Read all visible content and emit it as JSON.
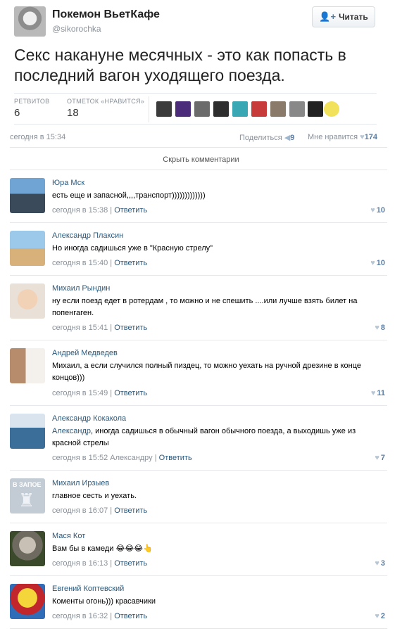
{
  "tweet": {
    "author_name": "Покемон ВьетКафе",
    "author_handle": "@sikorochka",
    "follow_label": "Читать",
    "text": "Секс накануне месячных - это как попасть в последний вагон уходящего поезда.",
    "retweets_label": "РЕТВИТОВ",
    "retweets_count": "6",
    "likes_label": "ОТМЕТОК «НРАВИТСЯ»",
    "likes_count": "18",
    "time": "сегодня в 15:34",
    "share_label": "Поделиться",
    "share_count": "9",
    "like_label": "Мне нравится",
    "like_count": "174"
  },
  "hide_comments_label": "Скрыть комментарии",
  "reply_label": "Ответить",
  "comments": [
    {
      "name": "Юра Мск",
      "text": "есть еще и запасной,,,,транспорт)))))))))))))",
      "time": "сегодня в 15:38",
      "likes": "10"
    },
    {
      "name": "Александр Плаксин",
      "text": "Но иногда садишься уже в \"Красную стрелу\"",
      "time": "сегодня в 15:40",
      "likes": "10"
    },
    {
      "name": "Михаил Рындин",
      "text": "ну если поезд едет в ротердам , то можно и не спешить ....или лучше взять билет на попенгаген.",
      "time": "сегодня в 15:41",
      "likes": "8"
    },
    {
      "name": "Андрей Медведев",
      "text": "Михаил, а если случился полный пиздец, то можно уехать на ручной дрезине в конце концов)))",
      "time": "сегодня в 15:49",
      "likes": "11"
    },
    {
      "name": "Александр Кокакола",
      "text_prefix": "Александр",
      "text": ", иногда садишься в обычный вагон обычного поезда, а выходишь уже из красной стрелы",
      "time": "сегодня в 15:52",
      "reply_to": "Александру",
      "likes": "7"
    },
    {
      "name": "Михаил Ирзыев",
      "avatar_text": "В ЗАПОЕ",
      "text": "главное сесть и уехать.",
      "time": "сегодня в 16:07",
      "likes": ""
    },
    {
      "name": "Мася Кот",
      "text": "Вам бы в камеди 😂😂😂👆",
      "time": "сегодня в 16:13",
      "likes": "3"
    },
    {
      "name": "Евгений Коптевский",
      "text": "Коменты огонь))) красавчики",
      "time": "сегодня в 16:32",
      "likes": "2"
    }
  ],
  "colors": {
    "link": "#2b587a",
    "muted": "#8a9199",
    "like_blue": "#5a7ea6"
  }
}
